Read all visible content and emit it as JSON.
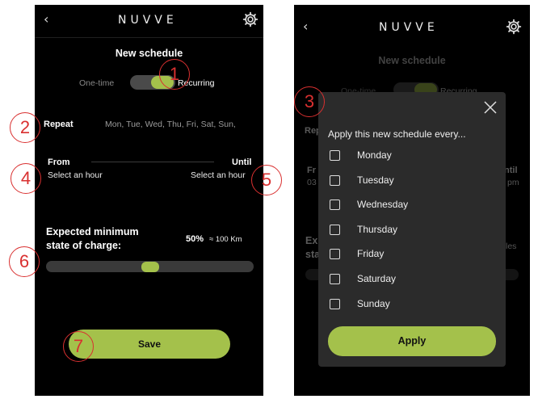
{
  "header": {
    "back_glyph": "‹",
    "logo_text": "NUVVE"
  },
  "left": {
    "title": "New schedule",
    "toggle": {
      "left_label": "One-time",
      "right_label": "Recurring",
      "selected": "Recurring"
    },
    "repeat": {
      "label": "Repeat",
      "value": "Mon, Tue, Wed, Thu, Fri, Sat, Sun,"
    },
    "from": {
      "label": "From",
      "value": "Select an hour"
    },
    "until": {
      "label": "Until",
      "value": "Select an hour"
    },
    "charge": {
      "label_line1": "Expected minimum",
      "label_line2": "state of charge:",
      "percent": "50%",
      "range": "≈ 100 Km",
      "level_fraction": 0.5
    },
    "save_label": "Save"
  },
  "right": {
    "background": {
      "title": "New schedule",
      "toggle_left": "One-time",
      "toggle_right": "Recurring",
      "repeat_label": "Repeat",
      "from_label": "Fr",
      "from_value": "03",
      "until_label": "ntil",
      "until_value": "pm",
      "charge_line1": "Ex",
      "charge_line2": "sta",
      "charge_suffix": "les"
    },
    "modal": {
      "title": "Apply this new schedule every...",
      "days": [
        "Monday",
        "Tuesday",
        "Wednesday",
        "Thursday",
        "Friday",
        "Saturday",
        "Sunday"
      ],
      "apply_label": "Apply"
    }
  },
  "callouts": [
    "1",
    "2",
    "3",
    "4",
    "5",
    "6",
    "7"
  ],
  "colors": {
    "accent": "#a4c14b",
    "callout": "#d93030",
    "background": "#000000",
    "modal": "#2b2b2b"
  },
  "icons": {
    "back": "chevron-left-icon",
    "settings": "gear-icon",
    "close": "close-icon",
    "checkbox": "checkbox-icon"
  }
}
